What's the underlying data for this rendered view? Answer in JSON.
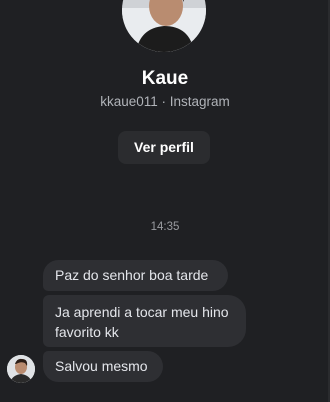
{
  "profile": {
    "name": "Kaue",
    "subtitle": "kkaue011 · Instagram",
    "view_profile_label": "Ver perfil"
  },
  "conversation": {
    "timestamp": "14:35",
    "messages": [
      {
        "text": "Paz do senhor boa tarde"
      },
      {
        "text": "Ja aprendi a tocar meu hino favorito kk"
      },
      {
        "text": "Salvou mesmo"
      }
    ]
  },
  "colors": {
    "background": "#1f2023",
    "bubble": "#2e2f33",
    "button": "#2b2c2f",
    "secondary_text": "#b0b3b8"
  },
  "icons": {
    "profile_avatar": "person-photo-avatar",
    "message_avatar": "person-photo-avatar"
  }
}
